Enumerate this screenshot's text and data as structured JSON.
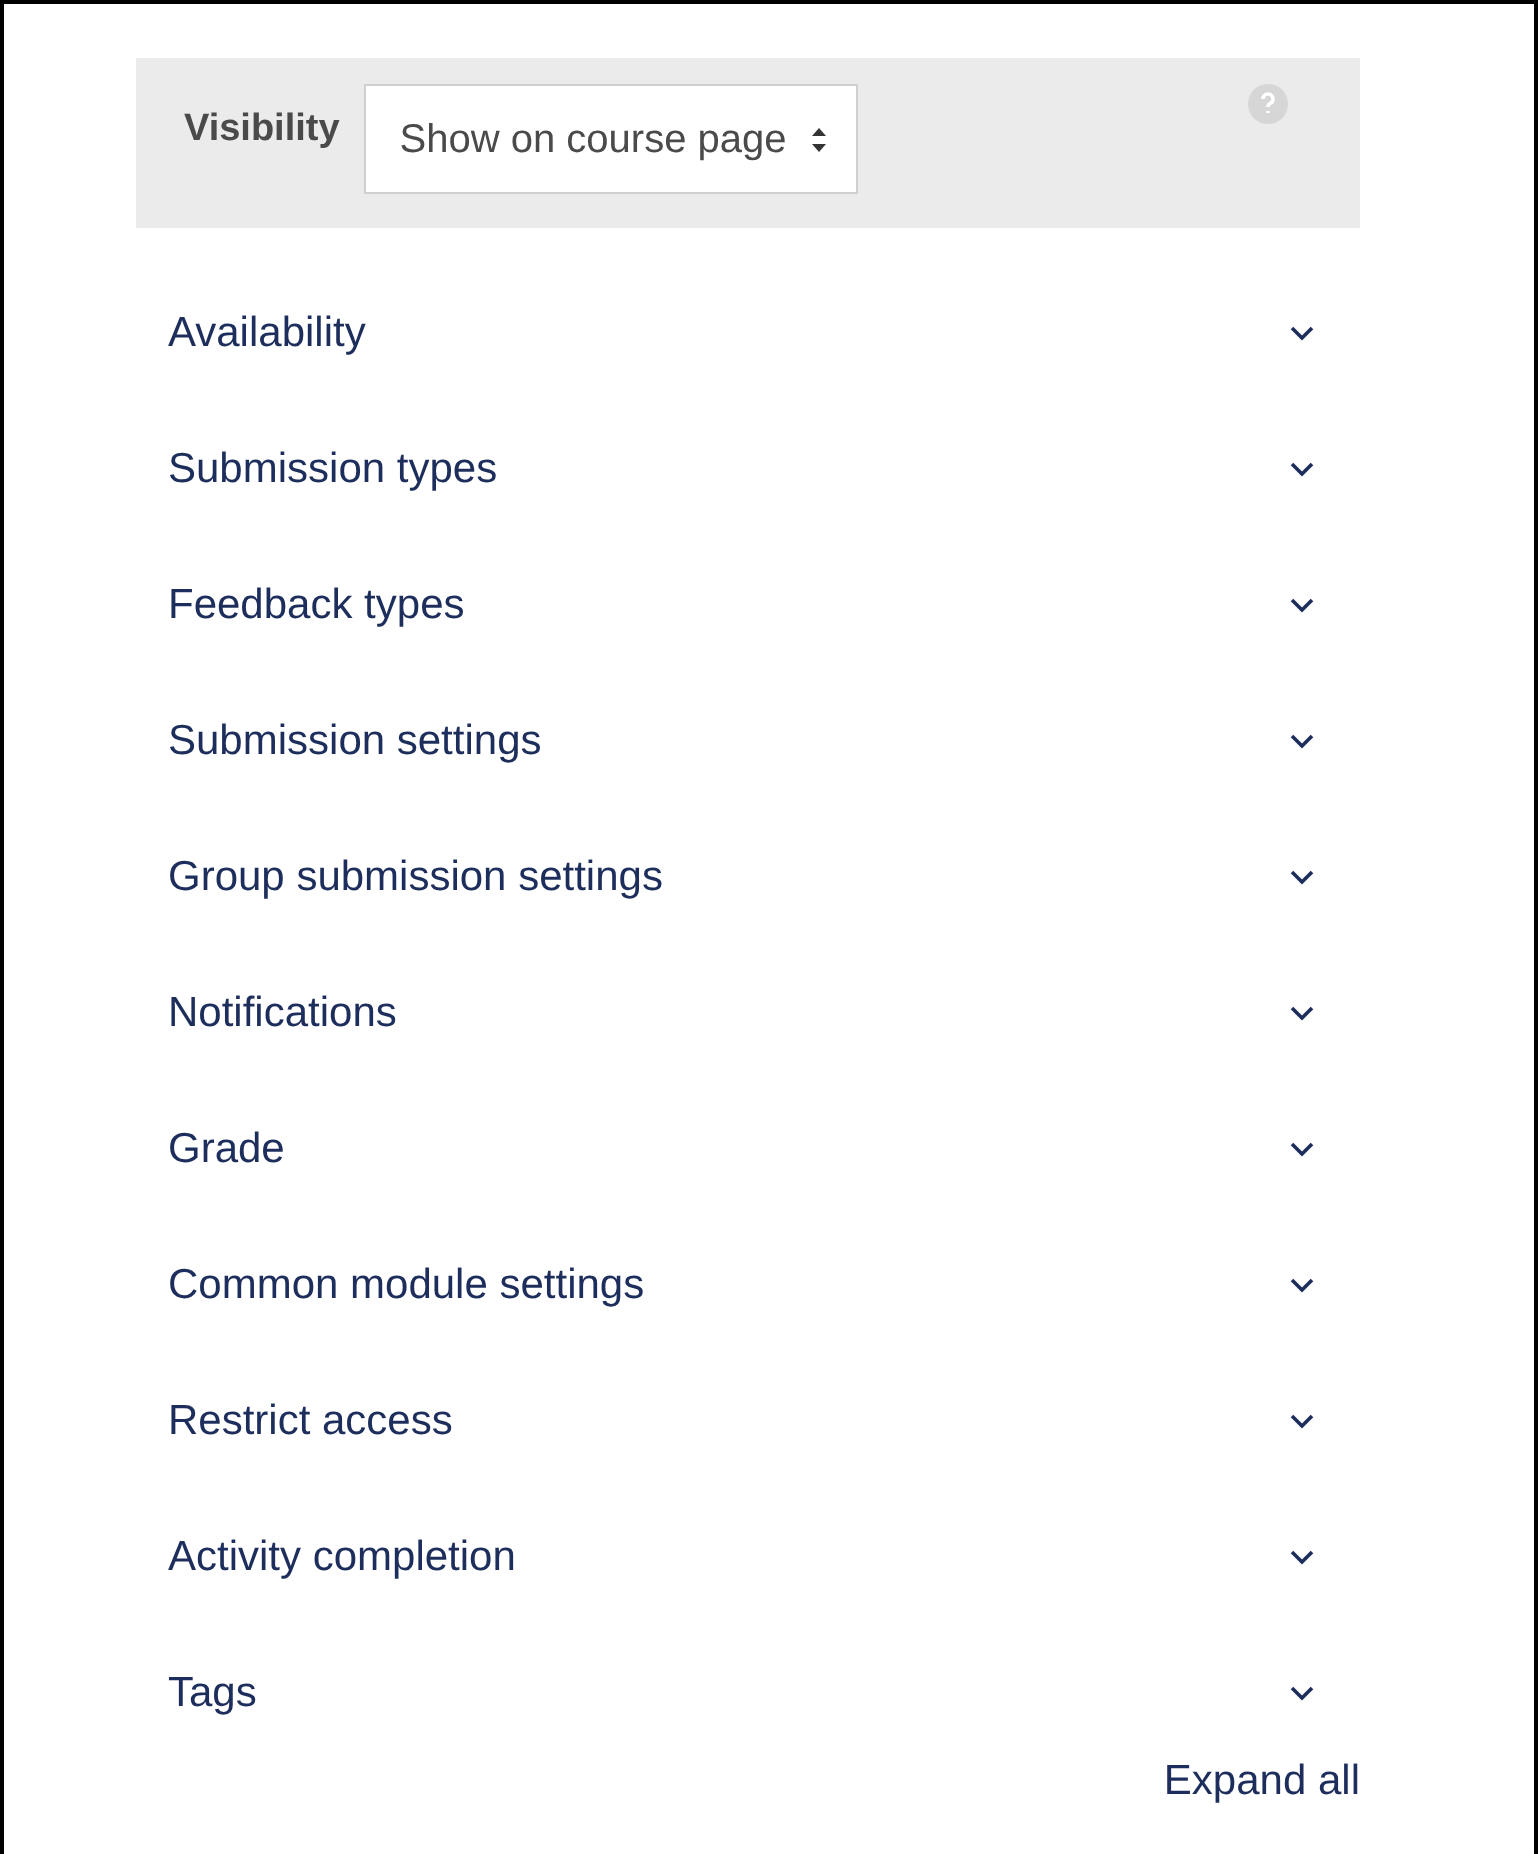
{
  "visibility": {
    "label": "Visibility",
    "value": "Show on course page"
  },
  "sections": [
    {
      "label": "Availability",
      "expanded": false
    },
    {
      "label": "Submission types",
      "expanded": false
    },
    {
      "label": "Feedback types",
      "expanded": false
    },
    {
      "label": "Submission settings",
      "expanded": false
    },
    {
      "label": "Group submission settings",
      "expanded": false
    },
    {
      "label": "Notifications",
      "expanded": false
    },
    {
      "label": "Grade",
      "expanded": false
    },
    {
      "label": "Common module settings",
      "expanded": false
    },
    {
      "label": "Restrict access",
      "expanded": false
    },
    {
      "label": "Activity completion",
      "expanded": false
    },
    {
      "label": "Tags",
      "expanded": false
    }
  ],
  "expand_all": "Expand all"
}
